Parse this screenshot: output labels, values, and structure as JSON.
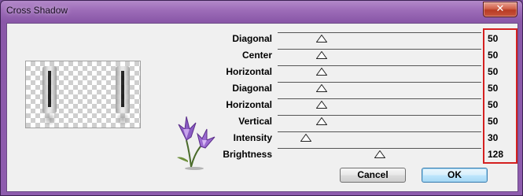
{
  "window": {
    "title": "Cross Shadow",
    "close_symbol": "✕"
  },
  "sliders": [
    {
      "label": "Diagonal",
      "value": "50",
      "fraction": 0.2
    },
    {
      "label": "Center",
      "value": "50",
      "fraction": 0.2
    },
    {
      "label": "Horizontal",
      "value": "50",
      "fraction": 0.2
    },
    {
      "label": "Diagonal",
      "value": "50",
      "fraction": 0.2
    },
    {
      "label": "Horizontal",
      "value": "50",
      "fraction": 0.2
    },
    {
      "label": "Vertical",
      "value": "50",
      "fraction": 0.2
    },
    {
      "label": "Intensity",
      "value": "30",
      "fraction": 0.12
    },
    {
      "label": "Brightness",
      "value": "128",
      "fraction": 0.5
    }
  ],
  "buttons": {
    "cancel": "Cancel",
    "ok": "OK"
  },
  "colors": {
    "highlight_box": "#d42020",
    "title_bar": "#9d6cb8"
  }
}
